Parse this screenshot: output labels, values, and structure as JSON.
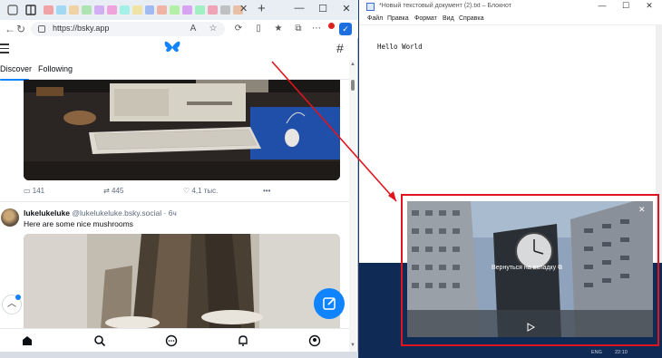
{
  "browser": {
    "url": "https://bsky.app",
    "window_controls": {
      "minimize": "—",
      "maximize": "☐",
      "close": "✕"
    },
    "new_tab": "+",
    "tab_close": "✕"
  },
  "bsky": {
    "feed_tabs": [
      {
        "label": "Discover"
      },
      {
        "label": "Following"
      }
    ],
    "post1": {
      "likes": "141",
      "reposts": "445",
      "likes_count": "4,1 тыс.",
      "more": "•••"
    },
    "post2": {
      "display_name": "lukelukeluke",
      "handle": "@lukelukeluke.bsky.social",
      "time": "· 6ч",
      "text": "Here are some nice mushrooms"
    },
    "hash": "#"
  },
  "notepad": {
    "title": "*Новый текстовый документ (2).txt – Блокнот",
    "menu": [
      "Файл",
      "Правка",
      "Формат",
      "Вид",
      "Справка"
    ],
    "content": "Hello World",
    "controls": {
      "minimize": "—",
      "maximize": "☐",
      "close": "✕"
    }
  },
  "pip": {
    "return_label": "Вернуться на вкладку",
    "close": "✕"
  },
  "taskbar": {
    "lang": "ENG",
    "time": "22:10"
  },
  "colors": {
    "bsky_blue": "#1083fe",
    "highlight_red": "#e0141e"
  }
}
